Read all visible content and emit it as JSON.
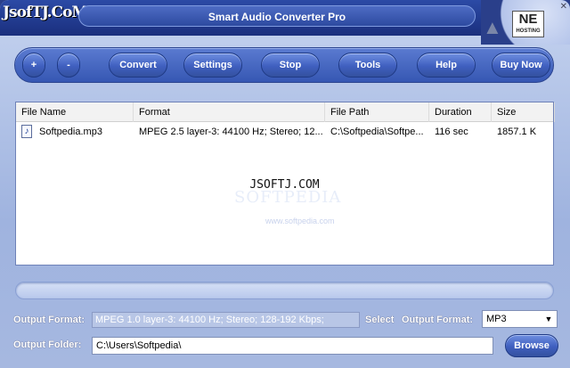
{
  "window": {
    "logo": "JsofTJ.CoM",
    "title": "Smart Audio Converter Pro",
    "corner_badge": "NE",
    "corner_badge_sub": "HOSTING"
  },
  "toolbar": {
    "add_label": "+",
    "remove_label": "-",
    "convert_label": "Convert",
    "settings_label": "Settings",
    "stop_label": "Stop",
    "tools_label": "Tools",
    "help_label": "Help",
    "buy_label": "Buy Now"
  },
  "file_list": {
    "columns": [
      "File Name",
      "Format",
      "File Path",
      "Duration",
      "Size"
    ],
    "rows": [
      {
        "file_name": "Softpedia.mp3",
        "format": "MPEG 2.5 layer-3: 44100 Hz;  Stereo; 12...",
        "file_path": "C:\\Softpedia\\Softpe...",
        "duration": "116 sec",
        "size": "1857.1 K"
      }
    ],
    "watermark": "JSOFTJ.COM",
    "softpedia_watermark": "SOFTPEDIA",
    "softpedia_url": "www.softpedia.com"
  },
  "output": {
    "format_label": "Output Format:",
    "format_value": "MPEG 1.0 layer-3: 44100 Hz; Stereo;  128-192 Kbps;",
    "select_label": "Select",
    "select_format_label": "Output Format:",
    "selected_format": "MP3",
    "folder_label": "Output Folder:",
    "folder_value": "C:\\Users\\Softpedia\\",
    "browse_label": "Browse"
  },
  "progress": {
    "value": 0
  }
}
